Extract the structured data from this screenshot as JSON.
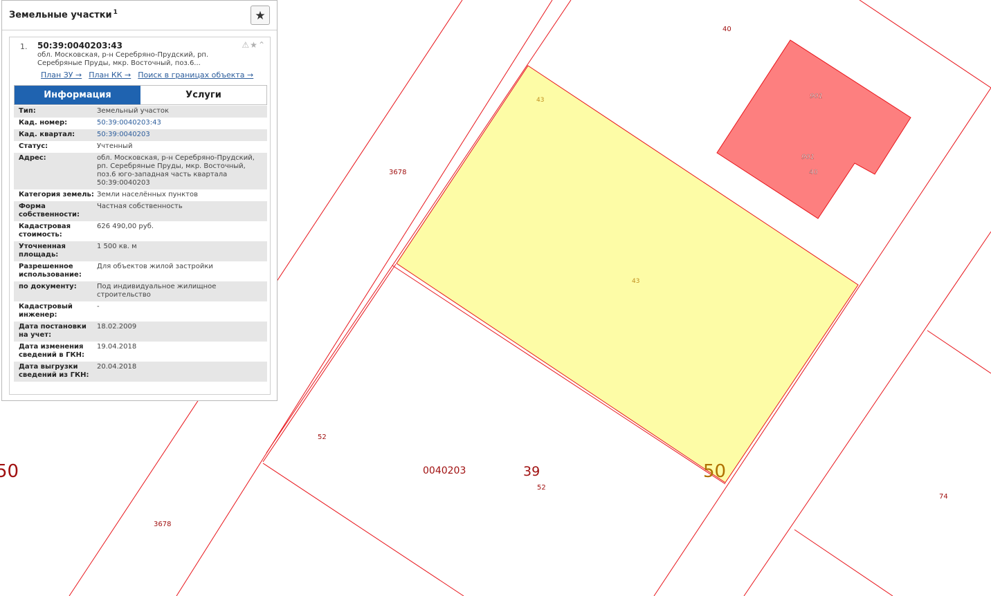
{
  "panel": {
    "title": "Земельные участки",
    "count": "1",
    "favorite_icon": "star-icon"
  },
  "result": {
    "index": "1.",
    "number": "50:39:0040203:43",
    "address_short": "обл. Московская, р-н Серебряно-Прудский, рп. Серебряные Пруды, мкр. Восточный, поз.6...",
    "icons": [
      "warning-icon",
      "star-icon",
      "chevron-up-icon"
    ],
    "links": [
      "План ЗУ →",
      "План КК →",
      "Поиск в границах объекта →"
    ]
  },
  "tabs": [
    "Информация",
    "Услуги"
  ],
  "info_rows": [
    {
      "label": "Тип:",
      "value": "Земельный участок"
    },
    {
      "label": "Кад. номер:",
      "value": "50:39:0040203:43"
    },
    {
      "label": "Кад. квартал:",
      "value": "50:39:0040203"
    },
    {
      "label": "Статус:",
      "value": "Учтенный"
    },
    {
      "label": "Адрес:",
      "value": "обл. Московская, р-н Серебряно-Прудский, рп. Серебряные Пруды, мкр. Восточный, поз.6 юго-западная часть квартала 50:39:0040203"
    },
    {
      "label": "Категория земель:",
      "value": "Земли населённых пунктов"
    },
    {
      "label": "Форма собственности:",
      "value": "Частная собственность"
    },
    {
      "label": "Кадастровая стоимость:",
      "value": "626 490,00 руб."
    },
    {
      "label": "Уточненная площадь:",
      "value": "1 500 кв. м"
    },
    {
      "label": "Разрешенное использование:",
      "value": "Для объектов жилой застройки"
    },
    {
      "label": "по документу:",
      "value": "Под индивидуальное жилищное строительство"
    },
    {
      "label": "Кадастровый инженер:",
      "value": "-"
    },
    {
      "label": "Дата постановки на учет:",
      "value": "18.02.2009"
    },
    {
      "label": "Дата изменения сведений в ГКН:",
      "value": "19.04.2018"
    },
    {
      "label": "Дата выгрузки сведений из ГКН:",
      "value": "20.04.2018"
    }
  ],
  "map_labels": {
    "l40_top": "40",
    "l901_a": "901",
    "l901_b": "901",
    "l40_building": "40",
    "l43_corner": "43",
    "l43_center": "43",
    "l3678_top": "3678",
    "l3678_bottom": "3678",
    "l52_left": "52",
    "l52_bottom": "52",
    "l74": "74",
    "quarter": "0040203",
    "district": "39",
    "region_right": "50",
    "region_left": "50"
  },
  "colors": {
    "boundary": "#e8141a",
    "selected_fill": "#fdfca6",
    "building_fill": "#fd7f7f",
    "label": "#a01010",
    "region_label": "#b07000",
    "tab_active": "#1f63b0",
    "link": "#2c5d9c"
  }
}
